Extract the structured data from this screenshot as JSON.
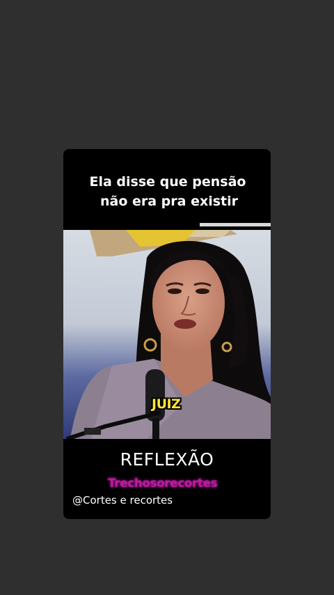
{
  "video_card": {
    "header_line_1": "Ela disse que pensão",
    "header_line_2": "não era pra existir",
    "caption_word": "JUIZ",
    "title": "REFLEXÃO",
    "subtitle": "Trechosorecortes",
    "channel_handle": "@Cortes e recortes"
  },
  "colors": {
    "background": "#2f2f2f",
    "card": "#000000",
    "caption": "#ffe33a",
    "subtitle": "#c01aa3"
  }
}
